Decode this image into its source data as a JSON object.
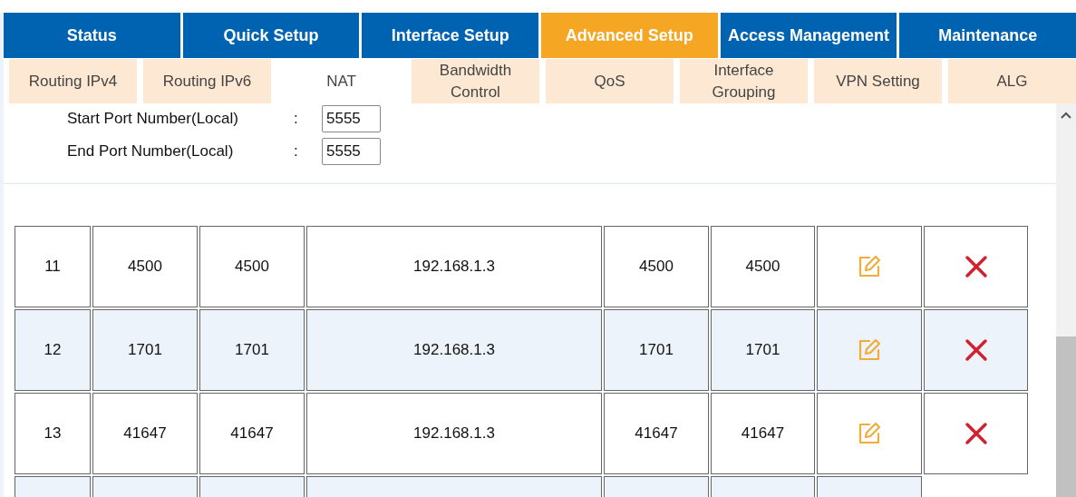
{
  "main_tabs": [
    {
      "label": "Status",
      "selected": false
    },
    {
      "label": "Quick Setup",
      "selected": false
    },
    {
      "label": "Interface Setup",
      "selected": false
    },
    {
      "label": "Advanced Setup",
      "selected": true
    },
    {
      "label": "Access Management",
      "selected": false
    },
    {
      "label": "Maintenance",
      "selected": false
    }
  ],
  "sub_tabs": [
    {
      "label": "Routing IPv4",
      "selected": false
    },
    {
      "label": "Routing IPv6",
      "selected": false
    },
    {
      "label": "NAT",
      "selected": true
    },
    {
      "label": "Bandwidth Control",
      "selected": false
    },
    {
      "label": "QoS",
      "selected": false
    },
    {
      "label": "Interface Grouping",
      "selected": false
    },
    {
      "label": "VPN Setting",
      "selected": false
    },
    {
      "label": "ALG",
      "selected": false
    }
  ],
  "form": [
    {
      "label": "Start Port Number(Local)",
      "separator": ":",
      "value": "5555"
    },
    {
      "label": "End Port Number(Local)",
      "separator": ":",
      "value": "5555"
    }
  ],
  "table": {
    "rows": [
      {
        "cells": [
          "11",
          "4500",
          "4500",
          "192.168.1.3",
          "4500",
          "4500"
        ]
      },
      {
        "cells": [
          "12",
          "1701",
          "1701",
          "192.168.1.3",
          "1701",
          "1701"
        ]
      },
      {
        "cells": [
          "13",
          "41647",
          "41647",
          "192.168.1.3",
          "41647",
          "41647"
        ]
      }
    ],
    "more_rows_below": true
  }
}
